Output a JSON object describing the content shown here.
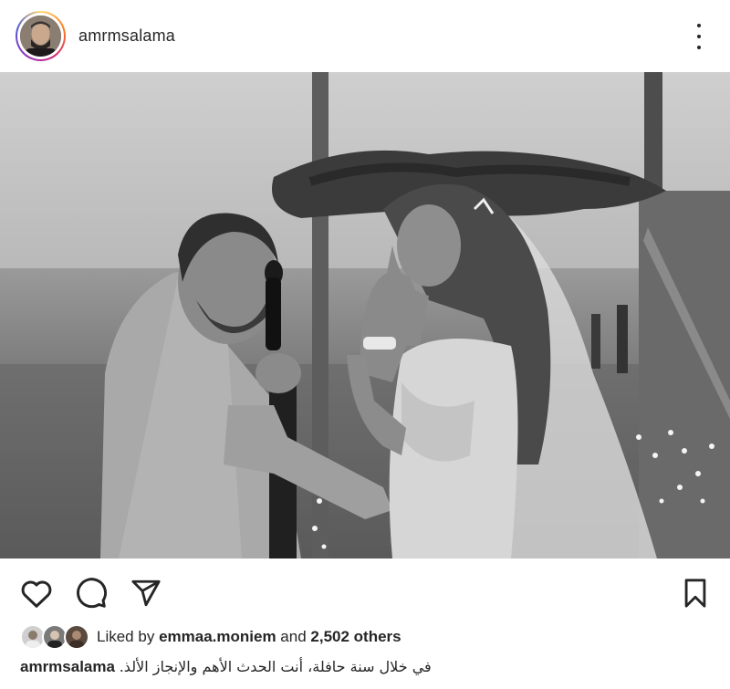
{
  "header": {
    "username": "amrmsalama",
    "more_icon": "more-vertical-icon"
  },
  "photo": {
    "style": "black-and-white"
  },
  "actions": {
    "like_icon": "heart-icon",
    "comment_icon": "comment-icon",
    "share_icon": "send-icon",
    "save_icon": "bookmark-icon"
  },
  "likes": {
    "prefix": "Liked by",
    "user": "emmaa.moniem",
    "conjunction": "and",
    "others": "2,502 others"
  },
  "caption": {
    "username": "amrmsalama",
    "text": "في خلال سنة حافلة، أنت الحدث الأهم والإنجاز الألذ."
  }
}
